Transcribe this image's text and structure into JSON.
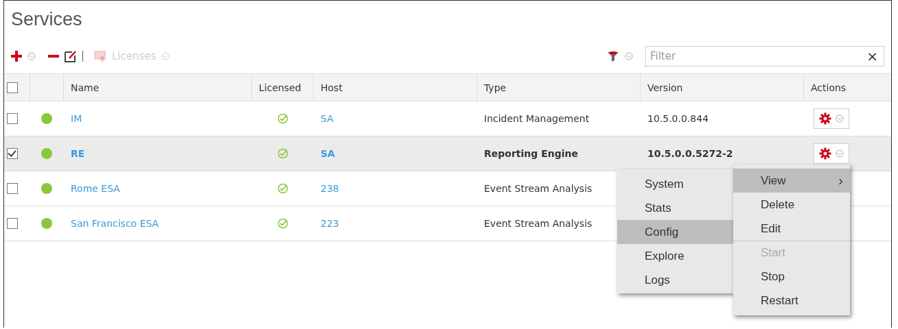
{
  "title": "Services",
  "toolbar": {
    "licenses": "Licenses",
    "filter": {
      "placeholder": "Filter",
      "clear": "×"
    }
  },
  "table": {
    "columns": [
      "Name",
      "Licensed",
      "Host",
      "Type",
      "Version",
      "Actions"
    ],
    "header_checked": false,
    "rows": [
      {
        "selected": false,
        "checked": false,
        "color": "#8cc63f",
        "name": "IM",
        "licensed": true,
        "host": "SA",
        "type": "Incident Management",
        "version": "10.5.0.0.844",
        "actions": {
          "kind": "gear"
        }
      },
      {
        "selected": true,
        "checked": true,
        "color": "#8cc63f",
        "name": "RE",
        "licensed": true,
        "host": "SA",
        "type": "Reporting Engine",
        "version": "10.5.0.0.5272-2",
        "actions": {
          "kind": "gear"
        }
      },
      {
        "selected": false,
        "checked": false,
        "color": "#8cc63f",
        "name": "Rome ESA",
        "licensed": true,
        "host": "238",
        "type": "Event Stream Analysis"
      },
      {
        "selected": false,
        "checked": false,
        "color": "#8cc63f",
        "name": "San Francisco ESA",
        "licensed": true,
        "host": "223",
        "type": "Event Stream Analysis"
      }
    ]
  },
  "context_menu": {
    "items": [
      {
        "label": "View",
        "arrow": "›",
        "selected": true,
        "disabled": false,
        "separator_before": false
      },
      {
        "label": "Delete",
        "selected": false,
        "disabled": false,
        "separator_before": false
      },
      {
        "label": "Edit",
        "selected": false,
        "disabled": false,
        "separator_before": false
      },
      {
        "label": "Start",
        "selected": false,
        "disabled": true,
        "separator_before": true
      },
      {
        "label": "Stop",
        "selected": false,
        "disabled": false,
        "separator_before": false
      },
      {
        "label": "Restart",
        "selected": false,
        "disabled": false,
        "separator_before": false
      }
    ]
  },
  "submenu": {
    "items": [
      {
        "label": "System",
        "selected": false
      },
      {
        "label": "Stats",
        "selected": false
      },
      {
        "label": "Config",
        "selected": true
      },
      {
        "label": "Explore",
        "selected": false
      },
      {
        "label": "Logs",
        "selected": false
      }
    ]
  }
}
